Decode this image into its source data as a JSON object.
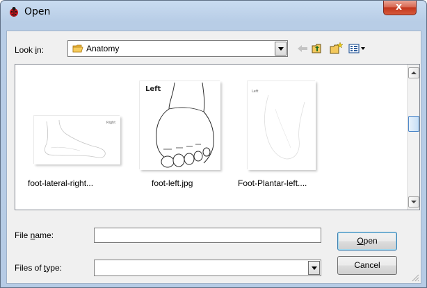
{
  "window": {
    "title": "Open",
    "close_glyph": "x",
    "icons": {
      "app": "ladybug-app-icon",
      "close": "close-icon"
    }
  },
  "toolbar": {
    "look_in_label_pre": "Look ",
    "look_in_label_mnemonic": "i",
    "look_in_label_post": "n:",
    "look_in_value": "Anatomy",
    "folder_icon": "folder-icon",
    "tools": [
      "back-arrow-icon",
      "up-folder-icon",
      "new-folder-icon",
      "view-menu-icon"
    ]
  },
  "files": [
    {
      "name": "foot-lateral-right...",
      "thumb_text": "Right"
    },
    {
      "name": "foot-left.jpg",
      "thumb_text": "Left"
    },
    {
      "name": "Foot-Plantar-left....",
      "thumb_text": "Left"
    }
  ],
  "form": {
    "file_name_label_pre": "File ",
    "file_name_label_mnemonic": "n",
    "file_name_label_post": "ame:",
    "file_name_value": "",
    "files_of_type_label_pre": "Files of ",
    "files_of_type_label_mnemonic": "t",
    "files_of_type_label_post": "ype:",
    "files_of_type_value": ""
  },
  "buttons": {
    "open_mnemonic": "O",
    "open_rest": "pen",
    "cancel": "Cancel"
  },
  "colors": {
    "title_bar": "#b9cfe8",
    "close_button": "#c8442a",
    "dialog_body": "#f0f0f0"
  }
}
